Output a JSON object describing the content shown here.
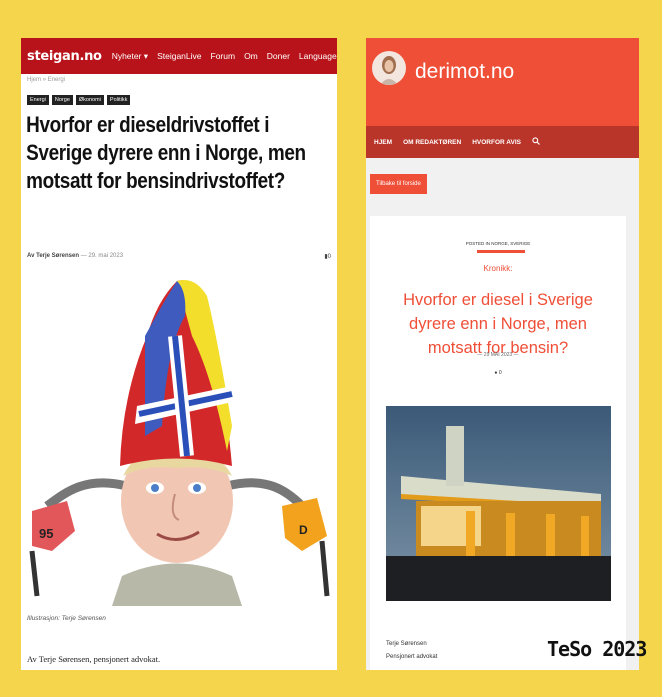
{
  "steigan": {
    "logo": "steigan.no",
    "nav": [
      "Nyheter ▾",
      "SteiganLive",
      "Forum",
      "Om",
      "Doner",
      "Languages ▾"
    ],
    "breadcrumb": "Hjem » Energi",
    "tags": [
      "Energi",
      "Norge",
      "Økonomi",
      "Politikk"
    ],
    "title": "Hvorfor er dieseldrivstoffet i Sverige dyrere enn i Norge, men motsatt for bensindrivstoffet?",
    "meta_author": "Av Terje Sørensen",
    "meta_date": " — 29. mai 2023",
    "comments_count": "0",
    "pump_left_label": "95",
    "pump_right_label": "D",
    "caption": "Illustrasjon: Terje Sørensen",
    "byline": "Av Terje Sørensen, pensjonert advokat."
  },
  "derimot": {
    "site_name": "derimot.no",
    "nav": [
      "HJEM",
      "OM REDAKTØREN",
      "HVORFOR AVIS"
    ],
    "back_button": "Tilbake til forside",
    "posted_in": "POSTED IN NORGE, SVERIGE",
    "category": "Kronikk:",
    "title": "Hvorfor er diesel i Sverige dyrere enn i Norge, men motsatt for bensin?",
    "date": "— 29 MAI 2023 —",
    "comments_count": "0",
    "author_name": "Terje Sørensen",
    "author_title": "Pensjonert advokat"
  },
  "signature": "TeSo 2023",
  "colors": {
    "background": "#f4d54c",
    "steigan_red": "#b8131a",
    "derimot_orange": "#ef4e37",
    "derimot_nav": "#b9352a"
  },
  "icons": [
    "comment-icon",
    "search-icon",
    "caret-down-icon"
  ]
}
